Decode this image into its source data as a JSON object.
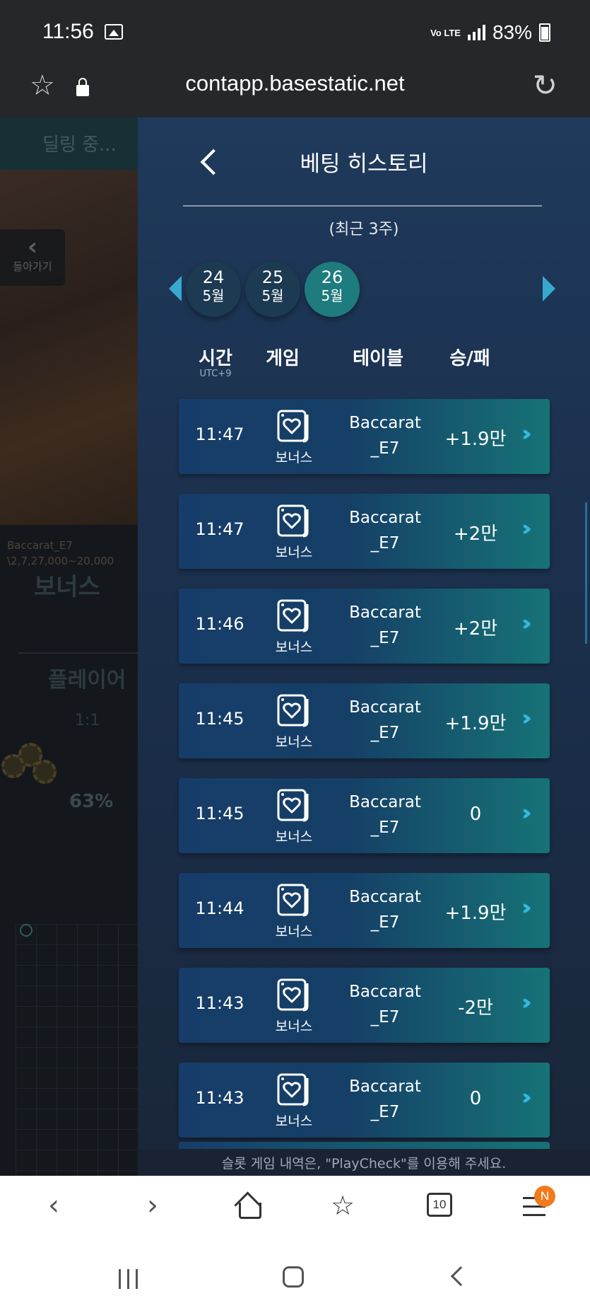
{
  "status_bar": {
    "time": "11:56",
    "network": "Vo LTE",
    "battery": "83%"
  },
  "url_bar": {
    "url": "contapp.basestatic.net"
  },
  "background_game": {
    "dealing_status": "딜링 중...",
    "back_label": "돌아가기",
    "table_caption_1": "Baccarat_E7",
    "table_caption_2": "\\2,7,27,000~20,000",
    "bonus_label": "보너스",
    "player_label": "플레이어",
    "payout": "1:1",
    "percent": "63%"
  },
  "panel": {
    "title": "베팅 히스토리",
    "subtitle": "(최근 3주)",
    "dates": [
      {
        "day": "24",
        "month": "5월",
        "active": false
      },
      {
        "day": "25",
        "month": "5월",
        "active": false
      },
      {
        "day": "26",
        "month": "5월",
        "active": true
      }
    ],
    "columns": {
      "time": "시간",
      "timezone": "UTC+9",
      "game": "게임",
      "table": "테이블",
      "result": "승/패"
    },
    "rows": [
      {
        "time": "11:47",
        "game": "보너스",
        "table_line1": "Baccarat",
        "table_line2": "_E7",
        "result": "+1.9만"
      },
      {
        "time": "11:47",
        "game": "보너스",
        "table_line1": "Baccarat",
        "table_line2": "_E7",
        "result": "+2만"
      },
      {
        "time": "11:46",
        "game": "보너스",
        "table_line1": "Baccarat",
        "table_line2": "_E7",
        "result": "+2만"
      },
      {
        "time": "11:45",
        "game": "보너스",
        "table_line1": "Baccarat",
        "table_line2": "_E7",
        "result": "+1.9만"
      },
      {
        "time": "11:45",
        "game": "보너스",
        "table_line1": "Baccarat",
        "table_line2": "_E7",
        "result": "0"
      },
      {
        "time": "11:44",
        "game": "보너스",
        "table_line1": "Baccarat",
        "table_line2": "_E7",
        "result": "+1.9만"
      },
      {
        "time": "11:43",
        "game": "보너스",
        "table_line1": "Baccarat",
        "table_line2": "_E7",
        "result": "-2만"
      },
      {
        "time": "11:43",
        "game": "보너스",
        "table_line1": "Baccarat",
        "table_line2": "_E7",
        "result": "0"
      }
    ],
    "footer": "슬롯 게임 내역은, \"PlayCheck\"를 이용해 주세요."
  },
  "browser_nav": {
    "tab_count": "10",
    "badge": "N"
  },
  "icons": {
    "game_icon": "card-heart-icon",
    "row_arrow": "double-chevron-right-icon"
  },
  "colors": {
    "accent": "#37a9cf",
    "active_date": "#1e7b7e",
    "row_gradient_end": "#167377",
    "badge": "#f07b1f"
  }
}
